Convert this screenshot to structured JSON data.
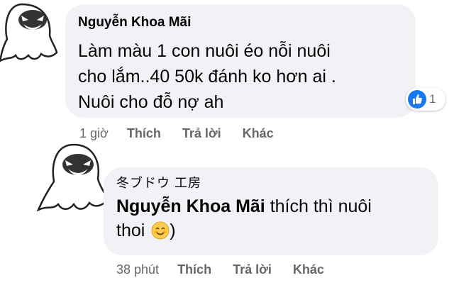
{
  "comment": {
    "author": "Nguyễn Khoa Mãi",
    "text_lines": [
      "Làm màu 1 con nuôi éo nỗi nuôi",
      "cho lắm..40 50k đánh ko hơn ai .",
      "Nuôi cho đỗ nợ ah"
    ],
    "reaction": {
      "icon": "like-icon",
      "count": "1",
      "color": "#1877f2"
    },
    "actions": {
      "time": "1 giờ",
      "like": "Thích",
      "reply": "Trả lời",
      "more": "Khác"
    }
  },
  "reply": {
    "author": "冬ブドウ 工房",
    "mention": "Nguyễn Khoa Mãi",
    "text_line1": " thích thì nuôi",
    "text_line2": "thoi",
    "emoji": "smiling-face-icon",
    "text_tail": ")",
    "actions": {
      "time": "38 phút",
      "like": "Thích",
      "reply": "Trả lời",
      "more": "Khác"
    }
  }
}
